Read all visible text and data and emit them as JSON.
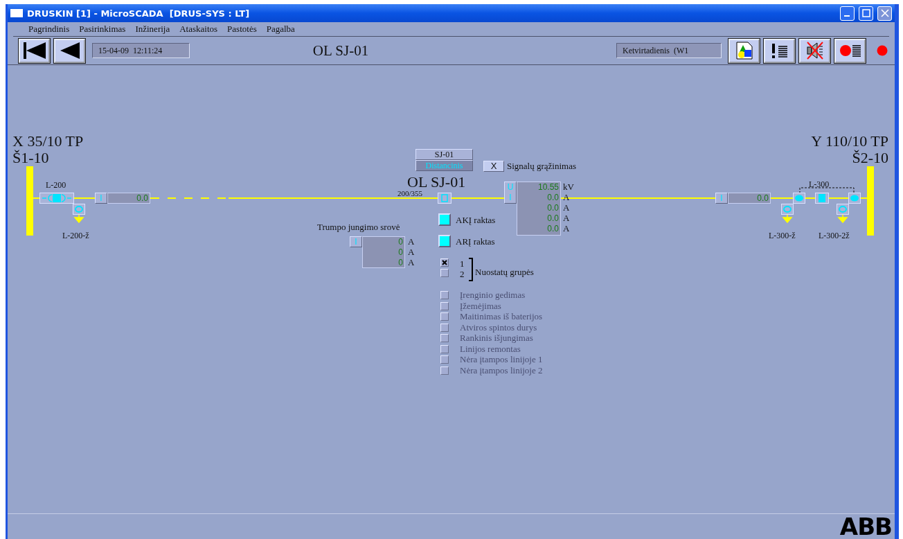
{
  "window": {
    "title": "DRUSKIN [1] - MicroSCADA  [DRUS-SYS : LT]"
  },
  "menu": [
    {
      "label": "Pagrindinis"
    },
    {
      "label": "Pasirinkimas"
    },
    {
      "label": "Inžinerija"
    },
    {
      "label": "Ataskaitos"
    },
    {
      "label": "Pastotės"
    },
    {
      "label": "Pagalba"
    }
  ],
  "toolbar": {
    "datetime": "15-04-09  12:11:24",
    "title": "OL SJ-01",
    "weekday": "Ketvirtadienis  (W1"
  },
  "diagram": {
    "left_station": {
      "name": "X 35/10 TP",
      "bus": "Š1-10"
    },
    "right_station": {
      "name": "Y 110/10 TP",
      "bus": "Š2-10"
    },
    "left_bay": {
      "label": "L-200",
      "earth_label": "L-200-ž",
      "meter": {
        "symbol": "I",
        "value": "0.0"
      }
    },
    "right_bay": {
      "label": "L-300",
      "earth_labels": [
        "L-300-ž",
        "L-300-2ž"
      ],
      "meter": {
        "symbol": "I",
        "value": "0.0"
      }
    },
    "recloser": {
      "name": "SJ-01",
      "mode": "Distancinis",
      "title": "OL SJ-01",
      "ratio": "200/355"
    },
    "signal_reset": {
      "button": "X",
      "label": "Signalų grąžinimas"
    },
    "measurements": {
      "symbols": [
        "U",
        "I"
      ],
      "rows": [
        {
          "value": "10.55",
          "unit": "kV"
        },
        {
          "value": "0.0",
          "unit": "A"
        },
        {
          "value": "0.0",
          "unit": "A"
        },
        {
          "value": "0.0",
          "unit": "A"
        },
        {
          "value": "0.0",
          "unit": "A"
        }
      ]
    },
    "keys": [
      {
        "label": "AKĮ raktas",
        "on": true
      },
      {
        "label": "ARĮ raktas",
        "on": true
      }
    ],
    "short_circuit": {
      "title": "Trumpo jungimo srovė",
      "symbol": "I",
      "rows": [
        {
          "value": "0",
          "unit": "A"
        },
        {
          "value": "0",
          "unit": "A"
        },
        {
          "value": "0",
          "unit": "A"
        }
      ]
    },
    "setting_groups": {
      "title": "Nuostatų grupės",
      "items": [
        {
          "label": "1",
          "checked": true
        },
        {
          "label": "2",
          "checked": false
        }
      ]
    },
    "alarms": [
      {
        "label": "Įrenginio gedimas",
        "disabled": true,
        "checked": false
      },
      {
        "label": "Įžemėjimas",
        "disabled": true,
        "checked": false
      },
      {
        "label": "Maitinimas iš baterijos",
        "disabled": true,
        "checked": false
      },
      {
        "label": "Atviros spintos durys",
        "disabled": true,
        "checked": false
      },
      {
        "label": "Rankinis išjungimas",
        "disabled": true,
        "checked": false
      },
      {
        "label": "Linijos remontas",
        "disabled": true,
        "checked": false
      },
      {
        "label": "Nėra įtampos linijoje 1",
        "disabled": true,
        "checked": false
      },
      {
        "label": "Nėra įtampos linijoje 2",
        "disabled": true,
        "checked": false
      }
    ]
  },
  "status_bar": {
    "logo": "ABB"
  }
}
